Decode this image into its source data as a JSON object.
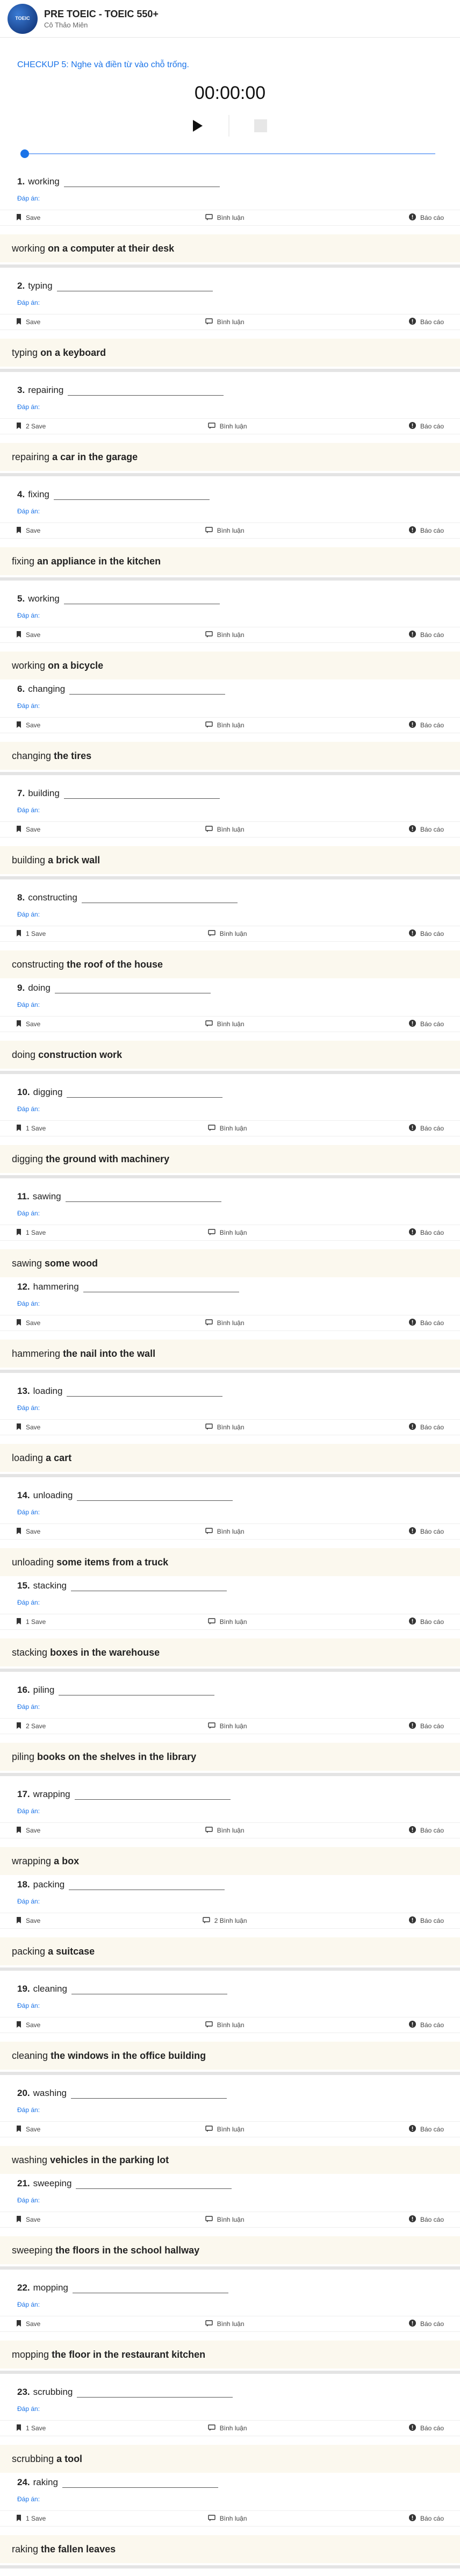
{
  "header": {
    "logo_text": "TOEIC",
    "course_title": "PRE TOEIC - TOEIC 550+",
    "teacher": "Cô Thảo Miên"
  },
  "instruction": "CHECKUP 5: Nghe và điền từ vào chỗ trống.",
  "player": {
    "time": "00:00:00",
    "progress": 0
  },
  "labels": {
    "answer": "Đáp án:",
    "save": "Save",
    "comment": "Bình luận",
    "report": "Báo cáo"
  },
  "questions": [
    {
      "num": "1.",
      "word": "working",
      "save": "Save",
      "comment": "Bình luận",
      "rest": "on a computer at their desk"
    },
    {
      "num": "2.",
      "word": "typing",
      "save": "Save",
      "comment": "Bình luận",
      "rest": "on a keyboard"
    },
    {
      "num": "3.",
      "word": "repairing",
      "save": "2 Save",
      "comment": "Bình luận",
      "rest": "a car in the garage"
    },
    {
      "num": "4.",
      "word": "fixing",
      "save": "Save",
      "comment": "Bình luận",
      "rest": "an appliance in the kitchen"
    },
    {
      "num": "5.",
      "word": "working",
      "save": "Save",
      "comment": "Bình luận",
      "rest": "on a bicycle"
    },
    {
      "num": "6.",
      "word": "changing",
      "save": "Save",
      "comment": "Bình luận",
      "rest": "the tires"
    },
    {
      "num": "7.",
      "word": "building",
      "save": "Save",
      "comment": "Bình luận",
      "rest": "a brick wall"
    },
    {
      "num": "8.",
      "word": "constructing",
      "save": "1 Save",
      "comment": "Bình luận",
      "rest": "the roof of the house"
    },
    {
      "num": "9.",
      "word": "doing",
      "save": "Save",
      "comment": "Bình luận",
      "rest": "construction work"
    },
    {
      "num": "10.",
      "word": "digging",
      "save": "1 Save",
      "comment": "Bình luận",
      "rest": "the ground with machinery"
    },
    {
      "num": "11.",
      "word": "sawing",
      "save": "1 Save",
      "comment": "Bình luận",
      "rest": "some wood"
    },
    {
      "num": "12.",
      "word": "hammering",
      "save": "Save",
      "comment": "Bình luận",
      "rest": "the nail into the wall"
    },
    {
      "num": "13.",
      "word": "loading",
      "save": "Save",
      "comment": "Bình luận",
      "rest": "a cart"
    },
    {
      "num": "14.",
      "word": "unloading",
      "save": "Save",
      "comment": "Bình luận",
      "rest": "some items from a truck"
    },
    {
      "num": "15.",
      "word": "stacking",
      "save": "1 Save",
      "comment": "Bình luận",
      "rest": "boxes in the warehouse"
    },
    {
      "num": "16.",
      "word": "piling",
      "save": "2 Save",
      "comment": "Bình luận",
      "rest": "books on the shelves in the library"
    },
    {
      "num": "17.",
      "word": "wrapping",
      "save": "Save",
      "comment": "Bình luận",
      "rest": "a box"
    },
    {
      "num": "18.",
      "word": "packing",
      "save": "Save",
      "comment": "2 Bình luận",
      "rest": "a suitcase"
    },
    {
      "num": "19.",
      "word": "cleaning",
      "save": "Save",
      "comment": "Bình luận",
      "rest": "the windows in the office building"
    },
    {
      "num": "20.",
      "word": "washing",
      "save": "Save",
      "comment": "Bình luận",
      "rest": "vehicles in the parking lot"
    },
    {
      "num": "21.",
      "word": "sweeping",
      "save": "Save",
      "comment": "Bình luận",
      "rest": "the floors in the school hallway"
    },
    {
      "num": "22.",
      "word": "mopping",
      "save": "Save",
      "comment": "Bình luận",
      "rest": "the floor in the restaurant kitchen"
    },
    {
      "num": "23.",
      "word": "scrubbing",
      "save": "1 Save",
      "comment": "Bình luận",
      "rest": "a tool"
    },
    {
      "num": "24.",
      "word": "raking",
      "save": "1 Save",
      "comment": "Bình luận",
      "rest": "the fallen leaves"
    }
  ]
}
